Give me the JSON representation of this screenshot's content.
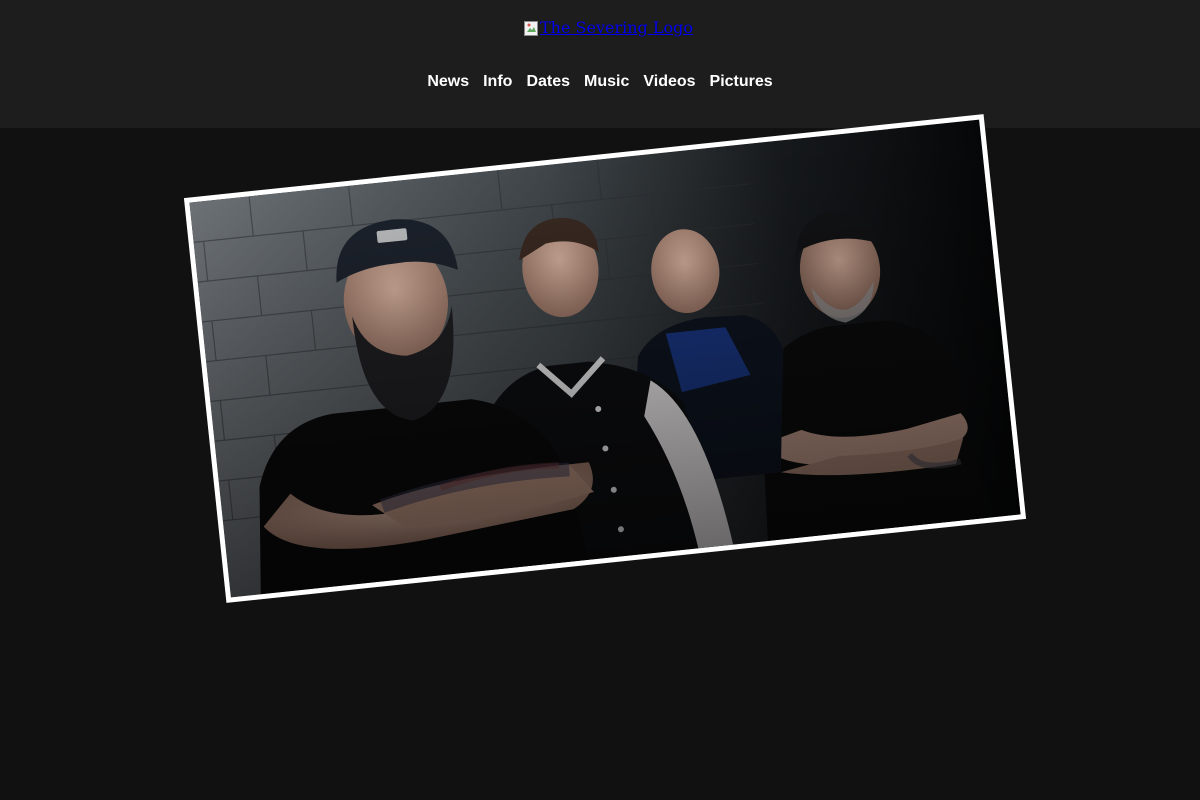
{
  "header": {
    "logo_alt": "The Severing Logo",
    "background": "#1d1d1d"
  },
  "nav": {
    "items": [
      {
        "label": "News"
      },
      {
        "label": "Info"
      },
      {
        "label": "Dates"
      },
      {
        "label": "Music"
      },
      {
        "label": "Videos"
      },
      {
        "label": "Pictures"
      }
    ]
  },
  "hero": {
    "description": "Band photo",
    "frame_color": "#ffffff"
  },
  "page": {
    "background": "#111111"
  }
}
